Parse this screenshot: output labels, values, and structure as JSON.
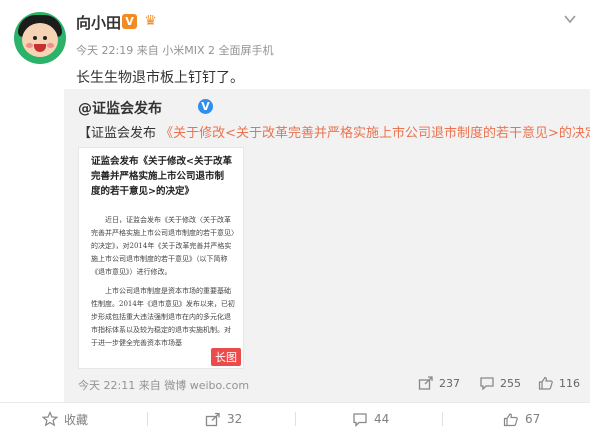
{
  "user": {
    "name": "向小田",
    "verified_badge": "V",
    "member_glyph": "♛"
  },
  "meta": {
    "time": "今天 22:19",
    "source_prefix": "来自",
    "source": "小米MIX 2 全面屏手机"
  },
  "post": {
    "text": "长生生物退市板上钉钉了。"
  },
  "repost": {
    "author": "@证监会发布",
    "verified_badge": "V",
    "text_prefix": "【证监会发布 ",
    "text_link": "《关于修改<关于改革完善并严格实施上市公司退市制度的若干意见>的决定》",
    "text_suffix": "】",
    "doc": {
      "title": "证监会发布《关于修改<关于改革完善并严格实施上市公司退市制度的若干意见>的决定》",
      "para1": "近日，证监会发布《关于修改〈关于改革完善并严格实施上市公司退市制度的若干意见〉的决定》，对2014年《关于改革完善并严格实施上市公司退市制度的若干意见》（以下简称《退市意见》）进行修改。",
      "para2": "上市公司退市制度是资本市场的重要基础性制度。2014年《退市意见》发布以来，已初步形成包括重大违法强制退市在内的多元化退市指标体系以及较为稳定的退市实施机制。对于进一步健全完善资本市场基",
      "long_badge": "长图"
    },
    "time": "今天 22:11",
    "source_prefix": "来自",
    "source": "微博 weibo.com",
    "share_count": "237",
    "comment_count": "255",
    "like_count": "116"
  },
  "actions": {
    "favorite_label": "收藏",
    "share_count": "32",
    "comment_count": "44",
    "like_count": "67"
  },
  "colors": {
    "link": "#eb7350",
    "badge_orange": "#f38b23",
    "badge_blue": "#2d8ff0",
    "long_badge": "#ec4b4b"
  }
}
